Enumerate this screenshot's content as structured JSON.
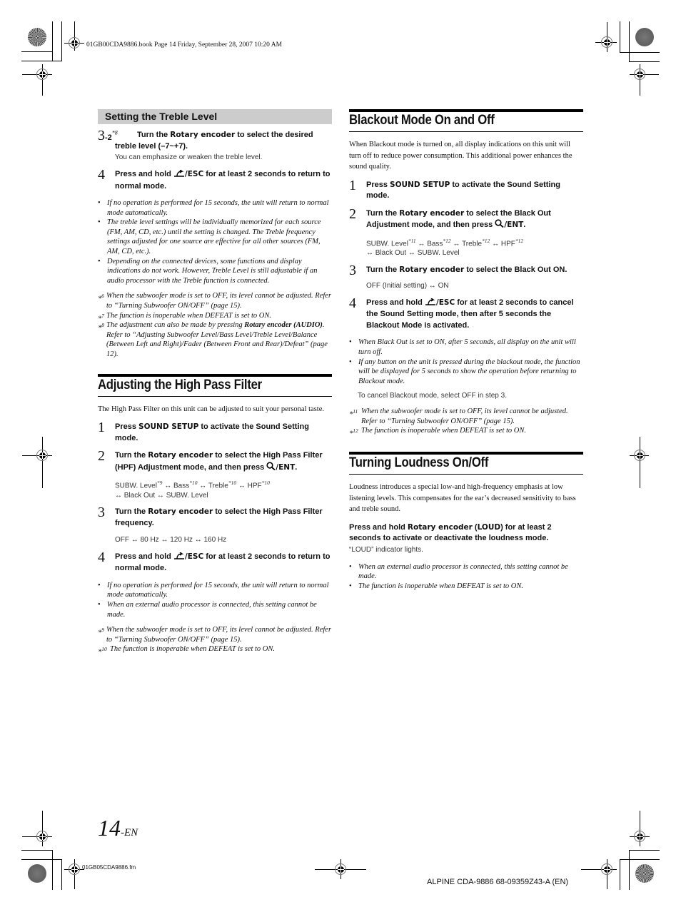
{
  "header": {
    "file_meta": "01GB00CDA9886.book  Page 14  Friday, September 28, 2007  10:20 AM"
  },
  "footer": {
    "page_number": "14",
    "page_suffix": "-EN",
    "file_name": "01GB05CDA9886.fm",
    "model_code": "ALPINE CDA-9886 68-09359Z43-A (EN)"
  },
  "icons": {
    "esc": "return-arrow-icon",
    "ent": "magnifier-icon"
  },
  "treble": {
    "title": "Setting the Treble Level",
    "step_3_2": {
      "num": "3",
      "sub": "-2",
      "sup": "*8",
      "pre": "Turn the ",
      "key": "Rotary encoder",
      "post": " to select the desired treble level (–7~+7).",
      "note": "You can emphasize or weaken the treble level."
    },
    "step_4": {
      "num": "4",
      "pre": "Press and hold ",
      "key": "/ESC",
      "post": " for at least 2 seconds to return to normal mode."
    },
    "bullets": [
      "If no operation is performed for 15 seconds, the unit will return to normal mode automatically.",
      "The treble level settings will be individually memorized for each source (FM, AM, CD, etc.) until the setting is changed. The Treble frequency settings adjusted for one source are effective for all other sources (FM, AM, CD, etc.).",
      "Depending on the connected devices, some functions and display indications do not work. However, Treble Level is still adjustable if an audio processor with the Treble function is connected."
    ],
    "footnotes": [
      {
        "mark": "*",
        "num": "6",
        "text": "When the subwoofer mode is set to OFF, its level cannot be adjusted. Refer to “Turning Subwoofer ON/OFF” (page 15)."
      },
      {
        "mark": "*",
        "num": "7",
        "text": "The function is inoperable when DEFEAT is set to ON."
      },
      {
        "mark": "*",
        "num": "8",
        "text_pre": "The adjustment can also be made by pressing ",
        "text_bold": "Rotary encoder (AUDIO)",
        "text_post": ". Refer to “Adjusting Subwoofer Level/Bass Level/Treble Level/Balance (Between Left and Right)/Fader (Between Front and Rear)/Defeat” (page 12)."
      }
    ]
  },
  "hpf": {
    "title": "Adjusting the High Pass Filter",
    "intro": "The High Pass Filter on this unit can be adjusted to suit your personal taste.",
    "step_1": {
      "num": "1",
      "pre": "Press ",
      "key": "SOUND SETUP",
      "post": " to activate the Sound Setting mode."
    },
    "step_2": {
      "num": "2",
      "pre": "Turn the ",
      "key": "Rotary encoder",
      "post": " to select the High Pass Filter (HPF) Adjustment mode, and then press ",
      "key2": "/ENT",
      "end": "."
    },
    "sequence_2": {
      "items": [
        "SUBW. Level",
        "Bass",
        "Treble",
        "HPF"
      ],
      "sups": [
        "*9",
        "*10",
        "*10",
        "*10"
      ],
      "tail": [
        "Black Out",
        "SUBW. Level"
      ],
      "arrow": "↔"
    },
    "step_3": {
      "num": "3",
      "pre": "Turn the ",
      "key": "Rotary encoder",
      "post": " to select the High Pass Filter frequency."
    },
    "sequence_3": [
      "OFF",
      "80 Hz",
      "120 Hz",
      "160 Hz"
    ],
    "step_4": {
      "num": "4",
      "pre": "Press and hold ",
      "key": "/ESC",
      "post": " for at least 2 seconds to return to normal mode."
    },
    "bullets": [
      "If no operation is performed for 15 seconds, the unit will return to normal mode automatically.",
      "When an external audio processor is connected, this setting cannot be made."
    ],
    "footnotes": [
      {
        "mark": "*",
        "num": "9",
        "text": "When the subwoofer mode is set to OFF, its level cannot be adjusted. Refer to “Turning Subwoofer ON/OFF” (page 15)."
      },
      {
        "mark": "*",
        "num": "10",
        "text": "The function is inoperable when DEFEAT is set to ON."
      }
    ]
  },
  "blackout": {
    "title": "Blackout Mode On and Off",
    "intro": "When Blackout mode is turned on, all display indications on this unit will turn off to reduce power consumption. This additional power enhances the sound quality.",
    "step_1": {
      "num": "1",
      "pre": "Press ",
      "key": "SOUND SETUP",
      "post": " to activate the Sound Setting mode."
    },
    "step_2": {
      "num": "2",
      "pre": "Turn the ",
      "key": "Rotary encoder",
      "post": " to select the Black Out Adjustment mode, and then press ",
      "key2": "/ENT",
      "end": "."
    },
    "sequence_2": {
      "items": [
        "SUBW. Level",
        "Bass",
        "Treble",
        "HPF"
      ],
      "sups": [
        "*11",
        "*12",
        "*12",
        "*12"
      ],
      "tail": [
        "Black Out",
        "SUBW. Level"
      ],
      "arrow": "↔"
    },
    "step_3": {
      "num": "3",
      "pre": "Turn the ",
      "key": "Rotary encoder",
      "post": " to select the Black Out ON."
    },
    "sequence_3": [
      "OFF (Initial setting)",
      "ON"
    ],
    "step_4": {
      "num": "4",
      "pre": "Press and hold ",
      "key": "/ESC",
      "post": " for at least 2 seconds to cancel the Sound Setting mode, then after 5 seconds the Blackout Mode is activated."
    },
    "bullets": [
      "When Black Out is set to ON, after 5 seconds, all display on the unit will turn off.",
      "If any button on the unit is pressed during the blackout mode, the function will be displayed for 5 seconds to show the operation before returning to Blackout mode."
    ],
    "cancel_note": "To cancel Blackout mode, select OFF in step 3.",
    "footnotes": [
      {
        "mark": "*",
        "num": "11",
        "text": "When the subwoofer mode is set to OFF, its level cannot be adjusted. Refer to “Turning Subwoofer ON/OFF” (page 15)."
      },
      {
        "mark": "*",
        "num": "12",
        "text": "The function is inoperable when DEFEAT is set to ON."
      }
    ]
  },
  "loudness": {
    "title": "Turning Loudness On/Off",
    "intro": "Loudness introduces a special low-and high-frequency emphasis at low listening levels. This compensates for the ear’s decreased sensitivity to bass and treble sound.",
    "instruction_pre": "Press and hold ",
    "instruction_key": "Rotary encoder",
    "instruction_mid": " (",
    "instruction_key2": "LOUD",
    "instruction_post": ") for at least 2 seconds to activate or deactivate the loudness mode.",
    "indicator_note": "“LOUD” indicator lights.",
    "bullets": [
      "When an external audio processor is connected, this setting cannot be made.",
      "The function is inoperable when DEFEAT is set to ON."
    ]
  }
}
